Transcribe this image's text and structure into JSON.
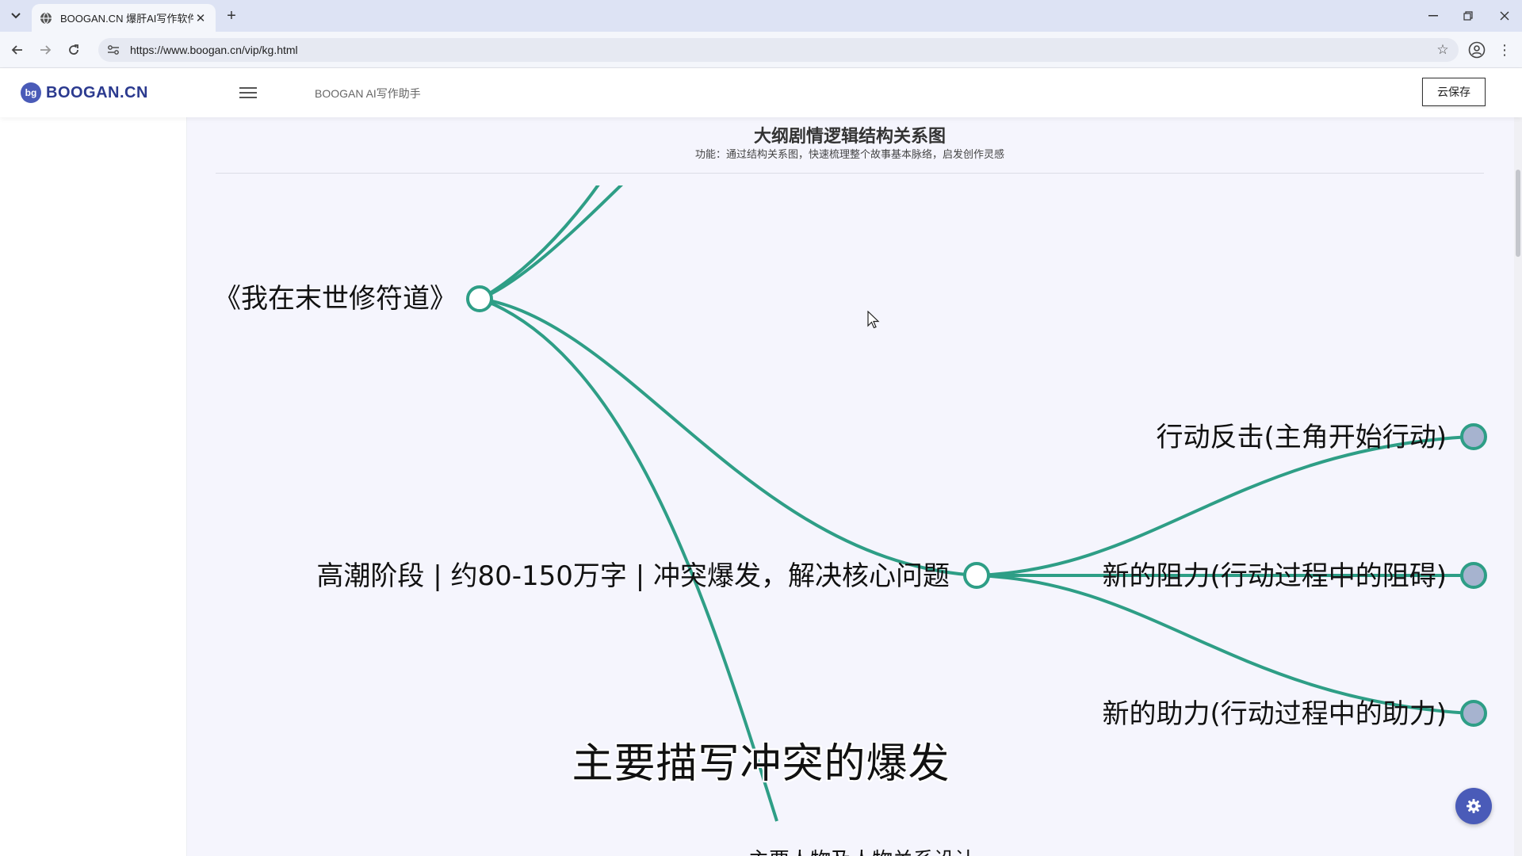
{
  "browser": {
    "tab_title": "BOOGAN.CN 爆肝AI写作软件",
    "url": "https://www.boogan.cn/vip/kg.html"
  },
  "site": {
    "logo_badge": "bg",
    "logo_text": "BOOGAN.CN",
    "header_title": "BOOGAN AI写作助手",
    "cloud_save_label": "云保存"
  },
  "panel": {
    "title": "大纲剧情逻辑结构关系图",
    "subtitle": "功能：通过结构关系图，快速梳理整个故事基本脉络，启发创作灵感"
  },
  "mindmap": {
    "root_label": "《我在末世修符道》",
    "stage_label": "高潮阶段 | 约80-150万字 | 冲突爆发，解决核心问题",
    "children": [
      "行动反击(主角开始行动)",
      "新的阻力(行动过程中的阻碍)",
      "新的助力(行动过程中的助力)"
    ],
    "partial_label": "主要人物及人物关系设计",
    "link_color": "#2e9e86",
    "node_fill_open": "#ffffff",
    "node_fill_collapsed": "#a6b3cf"
  },
  "overlay": {
    "video_subtitle": "主要描写冲突的爆发"
  },
  "colors": {
    "accent": "#4a5bb8",
    "link": "#2e9e86",
    "background": "#f5f5fd"
  },
  "icons": [
    "tab-search-icon",
    "globe-favicon-icon",
    "close-icon",
    "plus-icon",
    "minimize-icon",
    "restore-icon",
    "back-arrow-icon",
    "forward-arrow-icon",
    "reload-icon",
    "site-info-icon",
    "star-icon",
    "profile-icon",
    "more-vert-icon",
    "hamburger-menu-icon",
    "gear-icon",
    "cursor-icon"
  ]
}
